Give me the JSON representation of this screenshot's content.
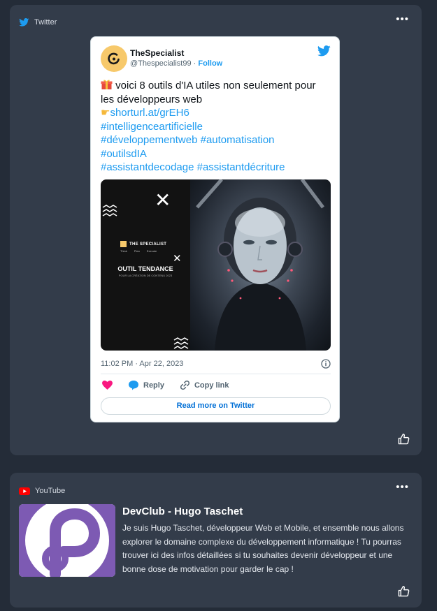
{
  "twitter_card": {
    "source_label": "Twitter",
    "tweet": {
      "author_name": "TheSpecialist",
      "author_handle": "@Thespecialist99",
      "separator": " · ",
      "follow_label": "Follow",
      "text_line1": "voici 8 outils  d'IA utiles non seulement pour les développeurs web",
      "link": "shorturl.at/grEH6",
      "hashtags": [
        "#intelligenceartificielle",
        "#développementweb #automatisation",
        "#outilsdIA",
        "#assistantdecodage #assistantdécriture"
      ],
      "media": {
        "brand": "THE SPECIALIST",
        "cols": [
          "Think",
          "Plan",
          "Execute"
        ],
        "headline": "OUTIL TENDANCE",
        "subline": "POUR LA CRÉATION DE CONTENU 2023"
      },
      "timestamp": "11:02 PM · Apr 22, 2023",
      "actions": {
        "reply": "Reply",
        "copy": "Copy link"
      },
      "read_more": "Read more on Twitter"
    }
  },
  "youtube_card": {
    "source_label": "YouTube",
    "title": "DevClub - Hugo Taschet",
    "description": "Je suis Hugo Taschet, développeur Web et Mobile, et ensemble nous allons explorer le domaine complexe du développement informatique ! Tu pourras trouver ici des infos détaillées si tu souhaites devenir développeur et une bonne dose de motivation pour garder le cap !"
  },
  "colors": {
    "background": "#242c38",
    "card": "#333c4a",
    "twitter_blue": "#1d9bf0",
    "youtube_red": "#ff0000",
    "heart": "#f91880",
    "devclub_purple": "#7d5ab3"
  },
  "icons": [
    "twitter-bird-icon",
    "more-icon",
    "thumbs-up-icon",
    "heart-icon",
    "reply-bubble-icon",
    "link-icon",
    "info-icon",
    "youtube-icon",
    "gift-emoji-icon",
    "pointing-hand-emoji-icon"
  ]
}
